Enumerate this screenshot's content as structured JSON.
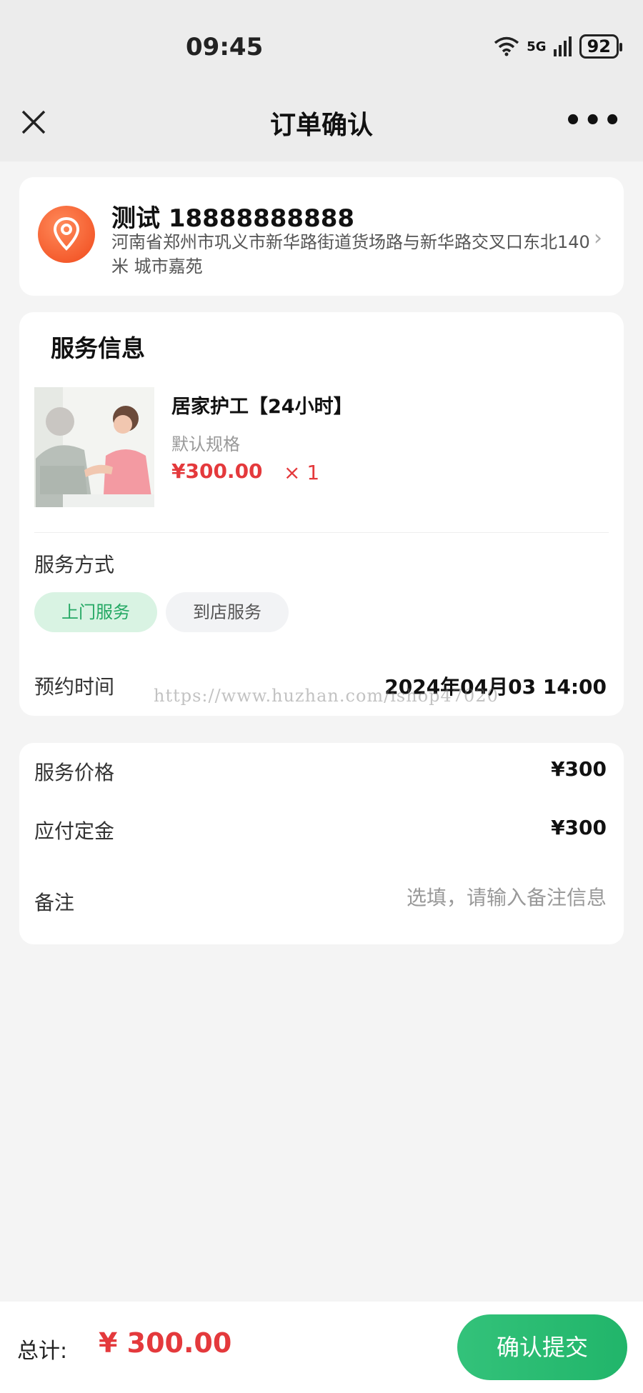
{
  "status_bar": {
    "time": "09:45",
    "network": "5G",
    "battery": "92"
  },
  "nav": {
    "title": "订单确认"
  },
  "address": {
    "name_phone": "测试 18888888888",
    "detail": "河南省郑州市巩义市新华路街道货场路与新华路交叉口东北140米 城市嘉苑"
  },
  "service": {
    "heading": "服务信息",
    "product": {
      "name": "居家护工【24小时】",
      "spec": "默认规格",
      "price": "¥300.00",
      "qty": "× 1"
    },
    "mode_label": "服务方式",
    "modes": [
      {
        "label": "上门服务",
        "selected": true
      },
      {
        "label": "到店服务",
        "selected": false
      }
    ],
    "time_label": "预约时间",
    "time_value": "2024年04月03 14:00"
  },
  "watermark": "https://www.huzhan.com/ishop47020",
  "pricing": {
    "rows": [
      {
        "label": "服务价格",
        "value": "¥300"
      },
      {
        "label": "应付定金",
        "value": "¥300"
      }
    ],
    "remark_label": "备注",
    "remark_placeholder": "选填，请输入备注信息"
  },
  "footer": {
    "total_label": "总计:",
    "total_value": "¥ 300.00",
    "submit_label": "确认提交"
  },
  "colors": {
    "accent_green": "#23a863",
    "price_red": "#e4393c",
    "pin_orange": "#f0491b"
  },
  "icons": [
    "close-icon",
    "more-icon",
    "location-pin-icon",
    "chevron-right-icon",
    "wifi-icon",
    "signal-icon",
    "battery-icon"
  ]
}
